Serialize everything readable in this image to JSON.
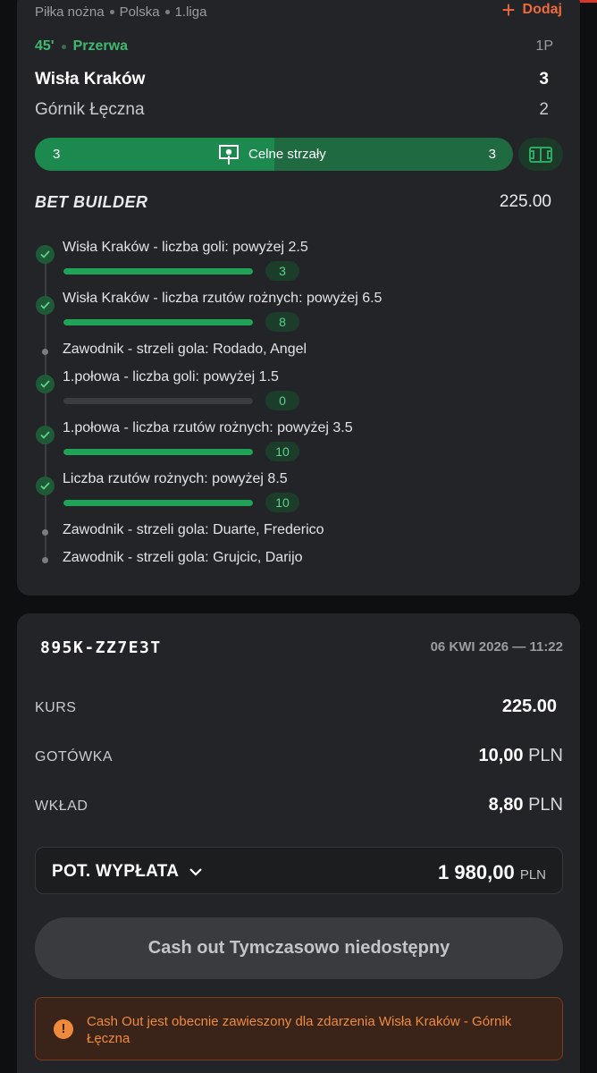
{
  "breadcrumb": [
    "Piłka nożna",
    "Polska",
    "1.liga"
  ],
  "add_button_label": "Dodaj",
  "match": {
    "minute": "45'",
    "status": "Przerwa",
    "period": "1P",
    "home": {
      "name": "Wisła Kraków",
      "score": "3"
    },
    "away": {
      "name": "Górnik Łęczna",
      "score": "2"
    }
  },
  "stat": {
    "label": "Celne strzały",
    "home_value": "3",
    "away_value": "3",
    "home_fraction": 0.5
  },
  "bet_builder": {
    "title": "BET BUILDER",
    "odds": "225.00",
    "legs": [
      {
        "label": "Wisła Kraków - liczba goli: powyżej 2.5",
        "settled": true,
        "count": "3",
        "progress": 1.0
      },
      {
        "label": "Wisła Kraków - liczba rzutów rożnych: powyżej 6.5",
        "settled": true,
        "count": "8",
        "progress": 1.0
      },
      {
        "label": "Zawodnik - strzeli gola: Rodado, Angel",
        "settled": false
      },
      {
        "label": "1.połowa - liczba goli: powyżej 1.5",
        "settled": true,
        "count": "0",
        "progress": 0.0
      },
      {
        "label": "1.połowa - liczba rzutów rożnych: powyżej 3.5",
        "settled": true,
        "count": "10",
        "progress": 1.0
      },
      {
        "label": "Liczba rzutów rożnych: powyżej 8.5",
        "settled": true,
        "count": "10",
        "progress": 1.0
      },
      {
        "label": "Zawodnik - strzeli gola: Duarte, Frederico",
        "settled": false
      },
      {
        "label": "Zawodnik - strzeli gola: Grujcic, Darijo",
        "settled": false
      }
    ]
  },
  "ticket": {
    "id": "895K-ZZ7E3T",
    "date": "06 KWI 2026 — 11:22",
    "kurs_label": "KURS",
    "kurs_value": "225.00",
    "gotowka_label": "GOTÓWKA",
    "gotowka_value": "10,00",
    "wklad_label": "WKŁAD",
    "wklad_value": "8,80",
    "currency": "PLN",
    "payout_label": "POT. WYPŁATA",
    "payout_value": "1 980,00",
    "cashout_label": "Cash out Tymczasowo niedostępny",
    "alert_text": "Cash Out jest obecnie zawieszony dla zdarzenia Wisła Kraków - Górnik Łęczna"
  },
  "colors": {
    "accent": "#ef6a3c",
    "live_green": "#3fb96f",
    "warning": "#ef8a3c"
  }
}
